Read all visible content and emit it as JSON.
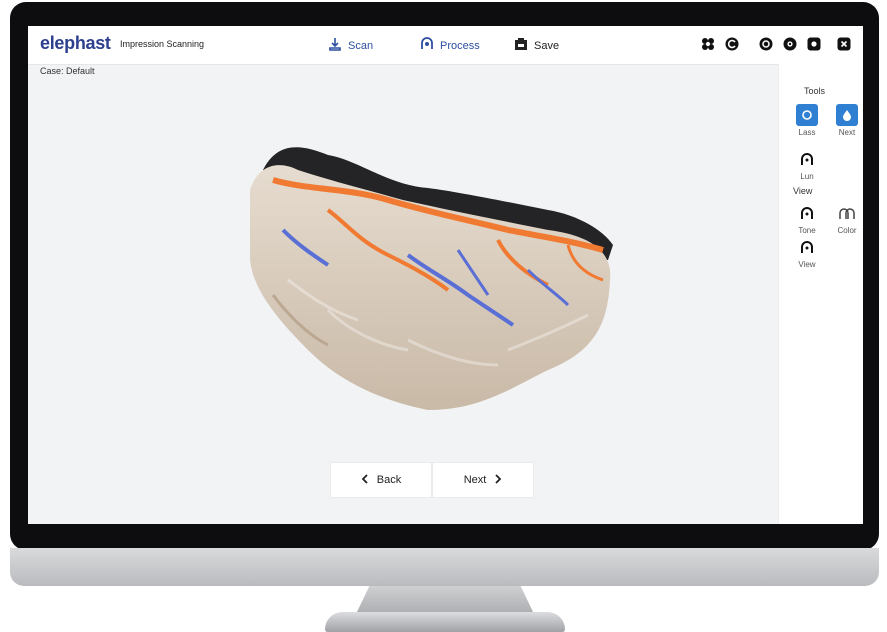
{
  "app": {
    "logo": "elephast",
    "subtitle": "Impression Scanning",
    "case_label": "Case: Default"
  },
  "nav": {
    "scan": "Scan",
    "process": "Process",
    "save": "Save"
  },
  "window_icons": [
    "settings-icon",
    "refresh-icon",
    "target-icon",
    "play-icon",
    "record-icon",
    "close-icon"
  ],
  "panel": {
    "tools_heading": "Tools",
    "tools": [
      {
        "label": "Lass",
        "icon": "circle-tool-icon",
        "active": true
      },
      {
        "label": "Next",
        "icon": "drop-tool-icon",
        "active": true
      },
      {
        "label": "Lun",
        "icon": "arch-tool-icon",
        "active": false
      }
    ],
    "view_heading": "View",
    "views": [
      {
        "label": "Tone",
        "icon": "arch-view-icon"
      },
      {
        "label": "Color",
        "icon": "double-arch-icon"
      },
      {
        "label": "View",
        "icon": "arch-view-icon"
      }
    ]
  },
  "footer": {
    "back": "Back",
    "next": "Next"
  },
  "colors": {
    "accent": "#2f7fd3",
    "brand": "#2d3f8f",
    "scan_orange": "#f07a32",
    "scan_blue": "#5a6fd6"
  }
}
